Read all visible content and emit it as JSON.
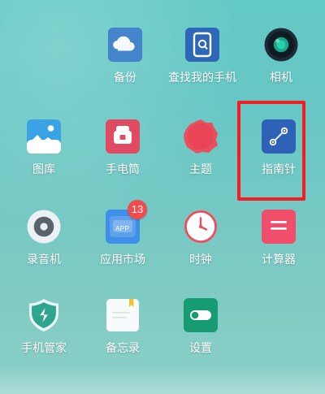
{
  "screen": {
    "apps": [
      {
        "label": "备份",
        "icon": "backup-icon"
      },
      {
        "label": "查找我的手机",
        "icon": "find-phone-icon"
      },
      {
        "label": "相机",
        "icon": "camera-icon"
      },
      {
        "label": "图库",
        "icon": "gallery-icon"
      },
      {
        "label": "手电筒",
        "icon": "flashlight-icon"
      },
      {
        "label": "主题",
        "icon": "theme-icon"
      },
      {
        "label": "指南针",
        "icon": "compass-icon",
        "highlighted": true
      },
      {
        "label": "录音机",
        "icon": "recorder-icon"
      },
      {
        "label": "应用市场",
        "icon": "app-store-icon",
        "badge": "13"
      },
      {
        "label": "时钟",
        "icon": "clock-icon"
      },
      {
        "label": "计算器",
        "icon": "calculator-icon"
      },
      {
        "label": "手机管家",
        "icon": "phone-manager-icon"
      },
      {
        "label": "备忘录",
        "icon": "notes-icon"
      },
      {
        "label": "设置",
        "icon": "settings-icon"
      }
    ]
  },
  "colors": {
    "background_top": "#63c9c4",
    "background_bottom": "#8ad0c7",
    "highlight": "#f21e23",
    "badge": "#f24b4b"
  }
}
